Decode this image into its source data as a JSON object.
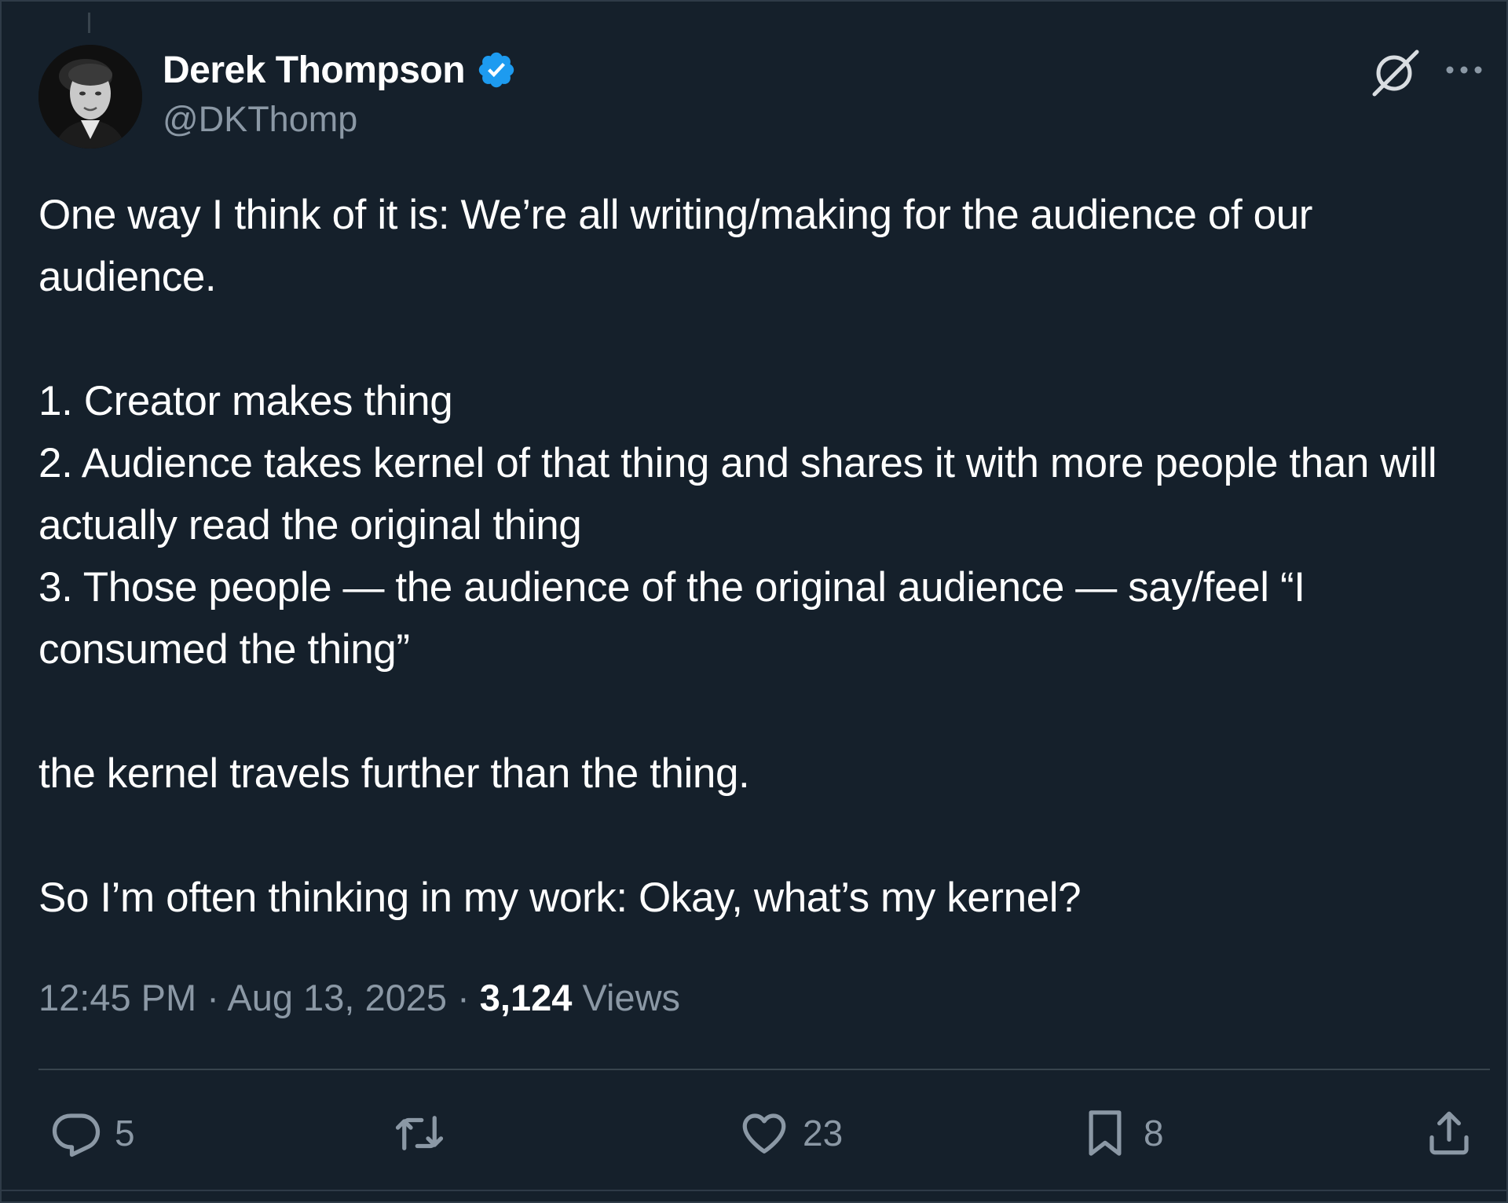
{
  "author": {
    "display_name": "Derek Thompson",
    "handle": "@DKThomp",
    "verified": true
  },
  "tweet": {
    "text": "One way I think of it is: We’re all writing/making for the audience of our audience.\n\n1. Creator makes thing\n2. Audience takes kernel of that thing and shares it with more people than will actually read the original thing\n3. Those people — the audience of the original audience — say/feel “I consumed the thing”\n\nthe kernel travels further than the thing.\n\nSo I’m often thinking in my work: Okay, what’s my kernel?",
    "time": "12:45 PM",
    "separator": "·",
    "date": "Aug 13, 2025",
    "views_count": "3,124",
    "views_label": "Views"
  },
  "actions": {
    "replies": "5",
    "reposts": "",
    "likes": "23",
    "bookmarks": "8"
  },
  "icons": {
    "verified": "verified-badge-icon",
    "grok": "grok-icon",
    "more": "more-icon",
    "reply": "reply-icon",
    "repost": "repost-icon",
    "like": "heart-icon",
    "bookmark": "bookmark-icon",
    "share": "share-icon"
  },
  "colors": {
    "background": "#15202b",
    "text": "#ffffff",
    "secondary_text": "#8b98a5",
    "verified_blue": "#1d9bf0",
    "divider": "#38444d"
  }
}
